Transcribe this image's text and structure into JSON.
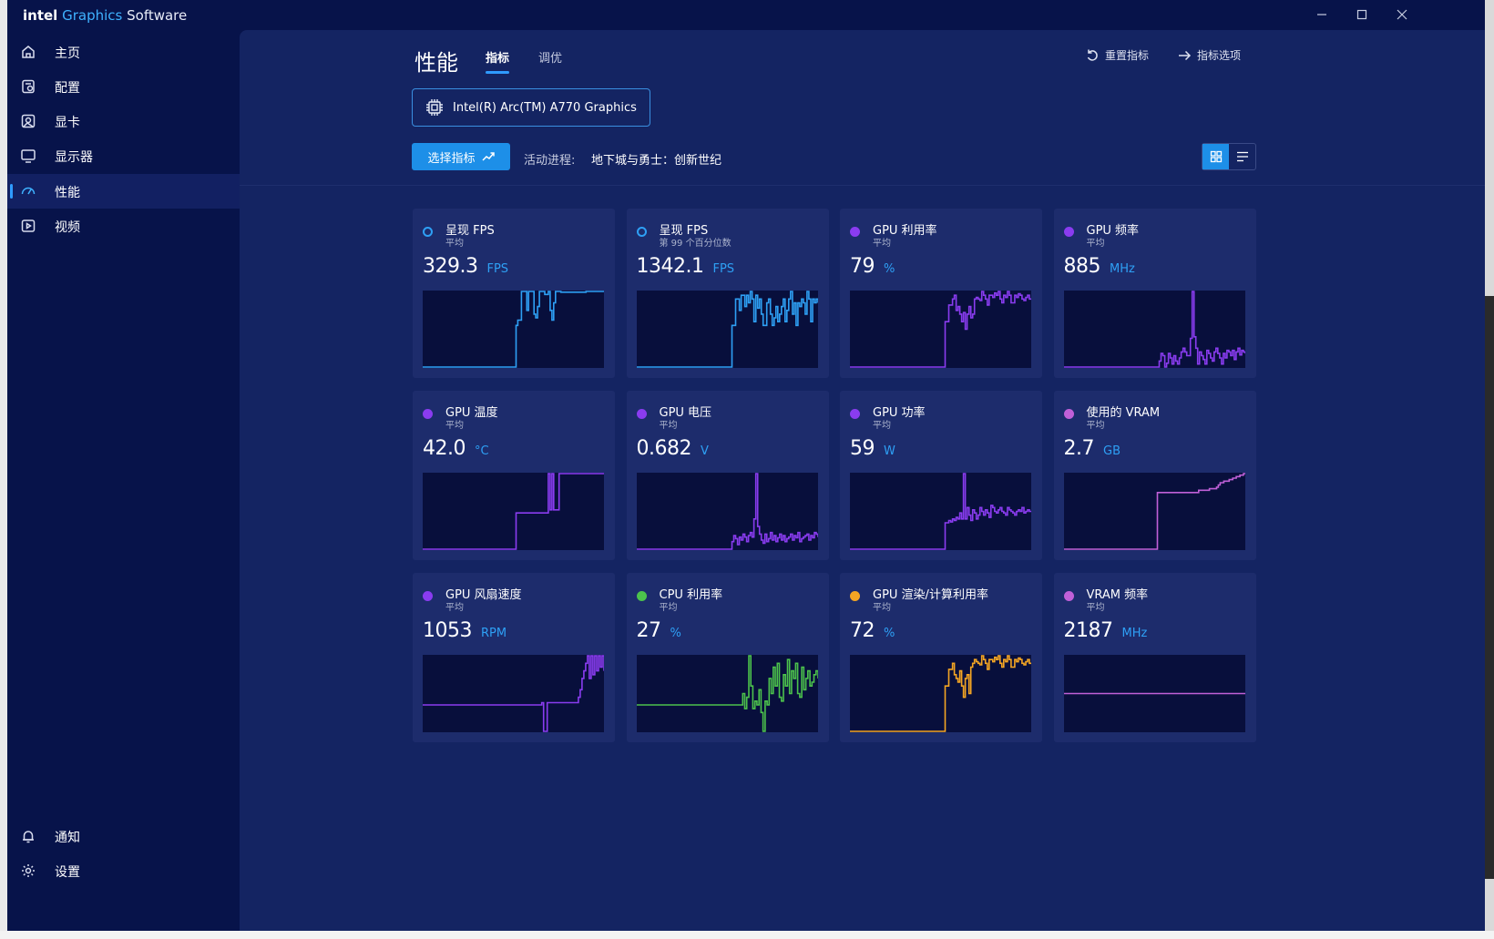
{
  "app": {
    "brand_intel": "intel",
    "brand_graphics": "Graphics",
    "brand_software": "Software"
  },
  "sidebar": {
    "items": [
      {
        "label": "主页",
        "icon": "home-icon"
      },
      {
        "label": "配置",
        "icon": "profile-icon"
      },
      {
        "label": "显卡",
        "icon": "graphics-card-icon"
      },
      {
        "label": "显示器",
        "icon": "monitor-icon"
      },
      {
        "label": "性能",
        "icon": "performance-gauge-icon",
        "active": true
      },
      {
        "label": "视频",
        "icon": "video-icon"
      }
    ],
    "bottom_items": [
      {
        "label": "通知",
        "icon": "bell-icon"
      },
      {
        "label": "设置",
        "icon": "settings-gear-icon"
      }
    ]
  },
  "header": {
    "title": "性能",
    "tabs": [
      {
        "label": "指标",
        "active": true
      },
      {
        "label": "调优",
        "active": false
      }
    ],
    "reset_label": "重置指标",
    "options_label": "指标选项"
  },
  "device": {
    "name": "Intel(R) Arc(TM) A770 Graphics"
  },
  "toolbar": {
    "select_metrics_label": "选择指标",
    "process_label": "活动进程:",
    "process_value": "地下城与勇士：创新世纪"
  },
  "colors": {
    "blue": "#2ea0f5",
    "purple": "#8a3cf0",
    "magenta": "#c060d8",
    "green": "#4cc24c",
    "orange": "#f5a623",
    "accent": "#1d8fe8"
  },
  "metrics": [
    {
      "title": "呈现 FPS",
      "sub": "平均",
      "value": "329.3",
      "unit": "FPS",
      "color": "#2ea0f5",
      "dot": "ring",
      "series": [
        0,
        0,
        0,
        0,
        0,
        0,
        0,
        0,
        0,
        0,
        0,
        0,
        0,
        0,
        0,
        0,
        0,
        0,
        0,
        0,
        0,
        0,
        0,
        0,
        0,
        0,
        0,
        0,
        0,
        0,
        0,
        0,
        0,
        0,
        0,
        0,
        0,
        0,
        0,
        0,
        0,
        0,
        0,
        0,
        0,
        0,
        0,
        0,
        0,
        0,
        0,
        0,
        55,
        62,
        62,
        100,
        100,
        100,
        75,
        100,
        100,
        100,
        70,
        65,
        80,
        100,
        100,
        100,
        96,
        96,
        100,
        75,
        62,
        85,
        100,
        100,
        100,
        99,
        99,
        99,
        99,
        99,
        99,
        99,
        99,
        99,
        99,
        99,
        99,
        99,
        99,
        100,
        100,
        100,
        100,
        100,
        100,
        100,
        100,
        100,
        100,
        100
      ]
    },
    {
      "title": "呈现 FPS",
      "sub": "第 99 个百分位数",
      "value": "1342.1",
      "unit": "FPS",
      "color": "#2ea0f5",
      "dot": "ring",
      "series": [
        0,
        0,
        0,
        0,
        0,
        0,
        0,
        0,
        0,
        0,
        0,
        0,
        0,
        0,
        0,
        0,
        0,
        0,
        0,
        0,
        0,
        0,
        0,
        0,
        0,
        0,
        0,
        0,
        0,
        0,
        0,
        0,
        0,
        0,
        0,
        0,
        0,
        0,
        0,
        0,
        0,
        0,
        0,
        0,
        0,
        0,
        0,
        0,
        0,
        0,
        0,
        0,
        55,
        55,
        90,
        90,
        75,
        95,
        95,
        80,
        95,
        85,
        100,
        90,
        60,
        95,
        78,
        90,
        70,
        55,
        55,
        85,
        90,
        70,
        55,
        65,
        80,
        60,
        70,
        80,
        90,
        60,
        75,
        90,
        100,
        70,
        85,
        55,
        85,
        80,
        90,
        85,
        70,
        100,
        90,
        60,
        90,
        85,
        90,
        85
      ]
    },
    {
      "title": "GPU 利用率",
      "sub": "平均",
      "value": "79",
      "unit": "%",
      "color": "#8a3cf0",
      "dot": "fill",
      "series": [
        0,
        0,
        0,
        0,
        0,
        0,
        0,
        0,
        0,
        0,
        0,
        0,
        0,
        0,
        0,
        0,
        0,
        0,
        0,
        0,
        0,
        0,
        0,
        0,
        0,
        0,
        0,
        0,
        0,
        0,
        0,
        0,
        0,
        0,
        0,
        0,
        0,
        0,
        0,
        0,
        0,
        0,
        0,
        0,
        0,
        0,
        0,
        0,
        0,
        0,
        0,
        0,
        60,
        60,
        82,
        82,
        90,
        95,
        75,
        80,
        70,
        60,
        72,
        50,
        70,
        80,
        65,
        70,
        90,
        92,
        90,
        88,
        100,
        95,
        90,
        82,
        95,
        95,
        92,
        98,
        95,
        100,
        90,
        85,
        95,
        92,
        100,
        95,
        85,
        85,
        95,
        92,
        97,
        95,
        90,
        88,
        92,
        95,
        90,
        90
      ]
    },
    {
      "title": "GPU 频率",
      "sub": "平均",
      "value": "885",
      "unit": "MHz",
      "color": "#8a3cf0",
      "dot": "fill",
      "series": [
        0,
        0,
        0,
        0,
        0,
        0,
        0,
        0,
        0,
        0,
        0,
        0,
        0,
        0,
        0,
        0,
        0,
        0,
        0,
        0,
        0,
        0,
        0,
        0,
        0,
        0,
        0,
        0,
        0,
        0,
        0,
        0,
        0,
        0,
        0,
        0,
        0,
        0,
        0,
        0,
        0,
        0,
        0,
        0,
        0,
        0,
        0,
        0,
        0,
        0,
        0,
        0,
        8,
        18,
        15,
        0,
        5,
        18,
        12,
        4,
        15,
        8,
        4,
        12,
        20,
        25,
        20,
        15,
        15,
        38,
        100,
        40,
        25,
        4,
        20,
        15,
        10,
        4,
        22,
        18,
        12,
        8,
        20,
        25,
        18,
        12,
        4,
        18,
        12,
        22,
        20,
        15,
        22,
        10,
        20,
        25,
        16,
        22,
        20,
        18
      ]
    },
    {
      "title": "GPU 温度",
      "sub": "平均",
      "value": "42.0",
      "unit": "°C",
      "color": "#8a3cf0",
      "dot": "fill",
      "series": [
        0,
        0,
        0,
        0,
        0,
        0,
        0,
        0,
        0,
        0,
        0,
        0,
        0,
        0,
        0,
        0,
        0,
        0,
        0,
        0,
        0,
        0,
        0,
        0,
        0,
        0,
        0,
        0,
        0,
        0,
        0,
        0,
        0,
        0,
        0,
        0,
        0,
        0,
        0,
        0,
        0,
        0,
        0,
        0,
        0,
        0,
        0,
        0,
        0,
        0,
        0,
        0,
        48,
        48,
        48,
        48,
        48,
        48,
        48,
        48,
        48,
        48,
        48,
        48,
        48,
        48,
        48,
        48,
        48,
        48,
        100,
        52,
        100,
        52,
        52,
        52,
        100,
        100,
        100,
        100,
        100,
        100,
        100,
        100,
        100,
        100,
        100,
        100,
        100,
        100,
        100,
        100,
        100,
        100,
        100,
        100,
        100,
        100,
        100,
        100,
        100,
        100
      ]
    },
    {
      "title": "GPU 电压",
      "sub": "平均",
      "value": "0.682",
      "unit": "V",
      "color": "#8a3cf0",
      "dot": "fill",
      "series": [
        0,
        0,
        0,
        0,
        0,
        0,
        0,
        0,
        0,
        0,
        0,
        0,
        0,
        0,
        0,
        0,
        0,
        0,
        0,
        0,
        0,
        0,
        0,
        0,
        0,
        0,
        0,
        0,
        0,
        0,
        0,
        0,
        0,
        0,
        0,
        0,
        0,
        0,
        0,
        0,
        0,
        0,
        0,
        0,
        0,
        0,
        0,
        0,
        0,
        0,
        0,
        0,
        10,
        18,
        14,
        6,
        16,
        12,
        20,
        16,
        10,
        18,
        22,
        16,
        40,
        100,
        30,
        20,
        12,
        8,
        20,
        10,
        14,
        22,
        12,
        18,
        10,
        15,
        20,
        12,
        18,
        10,
        14,
        16,
        20,
        12,
        18,
        15,
        22,
        10,
        14,
        16,
        18,
        20,
        12,
        18,
        15,
        22,
        20,
        16
      ]
    },
    {
      "title": "GPU 功率",
      "sub": "平均",
      "value": "59",
      "unit": "W",
      "color": "#8a3cf0",
      "dot": "fill",
      "series": [
        0,
        0,
        0,
        0,
        0,
        0,
        0,
        0,
        0,
        0,
        0,
        0,
        0,
        0,
        0,
        0,
        0,
        0,
        0,
        0,
        0,
        0,
        0,
        0,
        0,
        0,
        0,
        0,
        0,
        0,
        0,
        0,
        0,
        0,
        0,
        0,
        0,
        0,
        0,
        0,
        0,
        0,
        0,
        0,
        0,
        0,
        0,
        0,
        0,
        0,
        0,
        0,
        35,
        35,
        38,
        36,
        40,
        38,
        42,
        40,
        48,
        40,
        100,
        40,
        55,
        45,
        38,
        52,
        48,
        40,
        45,
        55,
        50,
        45,
        52,
        48,
        42,
        58,
        55,
        50,
        48,
        52,
        55,
        50,
        48,
        45,
        55,
        52,
        50,
        48,
        45,
        50,
        52,
        50,
        55,
        48,
        50,
        52,
        50,
        50
      ]
    },
    {
      "title": "使用的 VRAM",
      "sub": "平均",
      "value": "2.7",
      "unit": "GB",
      "color": "#c060d8",
      "dot": "fill",
      "series": [
        0,
        0,
        0,
        0,
        0,
        0,
        0,
        0,
        0,
        0,
        0,
        0,
        0,
        0,
        0,
        0,
        0,
        0,
        0,
        0,
        0,
        0,
        0,
        0,
        0,
        0,
        0,
        0,
        0,
        0,
        0,
        0,
        0,
        0,
        0,
        0,
        0,
        0,
        0,
        0,
        0,
        0,
        0,
        0,
        0,
        0,
        0,
        0,
        0,
        0,
        0,
        0,
        75,
        75,
        75,
        75,
        75,
        75,
        75,
        75,
        75,
        75,
        75,
        75,
        75,
        75,
        75,
        75,
        75,
        75,
        75,
        75,
        75,
        75,
        75,
        78,
        78,
        78,
        78,
        78,
        78,
        80,
        80,
        80,
        80,
        82,
        85,
        88,
        88,
        90,
        90,
        90,
        92,
        92,
        94,
        94,
        96,
        96,
        98,
        98,
        100,
        100
      ]
    },
    {
      "title": "GPU 风扇速度",
      "sub": "平均",
      "value": "1053",
      "unit": "RPM",
      "color": "#8a3cf0",
      "dot": "fill",
      "series": [
        35,
        35,
        35,
        35,
        35,
        35,
        35,
        35,
        35,
        35,
        35,
        35,
        35,
        35,
        35,
        35,
        35,
        35,
        35,
        35,
        35,
        35,
        35,
        35,
        35,
        35,
        35,
        35,
        35,
        35,
        35,
        35,
        35,
        35,
        35,
        35,
        35,
        35,
        35,
        35,
        35,
        35,
        35,
        35,
        35,
        35,
        35,
        35,
        35,
        35,
        35,
        35,
        35,
        35,
        35,
        35,
        35,
        35,
        35,
        35,
        35,
        35,
        35,
        35,
        35,
        38,
        0,
        0,
        38,
        38,
        38,
        38,
        38,
        38,
        38,
        38,
        38,
        38,
        38,
        38,
        38,
        38,
        38,
        38,
        38,
        45,
        55,
        70,
        80,
        90,
        100,
        70,
        100,
        75,
        100,
        80,
        100,
        85,
        100,
        80
      ]
    },
    {
      "title": "CPU 利用率",
      "sub": "平均",
      "value": "27",
      "unit": "%",
      "color": "#4cc24c",
      "dot": "fill",
      "series": [
        35,
        35,
        35,
        35,
        35,
        35,
        35,
        35,
        35,
        35,
        35,
        35,
        35,
        35,
        35,
        35,
        35,
        35,
        35,
        35,
        35,
        35,
        35,
        35,
        35,
        35,
        35,
        35,
        35,
        35,
        35,
        35,
        35,
        35,
        35,
        35,
        35,
        35,
        35,
        35,
        35,
        35,
        35,
        35,
        35,
        35,
        35,
        35,
        35,
        35,
        35,
        35,
        50,
        30,
        45,
        100,
        60,
        30,
        40,
        35,
        55,
        25,
        0,
        40,
        35,
        70,
        50,
        85,
        60,
        90,
        45,
        40,
        75,
        60,
        95,
        50,
        80,
        70,
        90,
        50,
        45,
        85,
        55,
        70,
        80,
        60,
        65,
        75,
        80,
        70
      ]
    },
    {
      "title": "GPU 渲染/计算利用率",
      "sub": "平均",
      "value": "72",
      "unit": "%",
      "color": "#f5a623",
      "dot": "fill",
      "series": [
        0,
        0,
        0,
        0,
        0,
        0,
        0,
        0,
        0,
        0,
        0,
        0,
        0,
        0,
        0,
        0,
        0,
        0,
        0,
        0,
        0,
        0,
        0,
        0,
        0,
        0,
        0,
        0,
        0,
        0,
        0,
        0,
        0,
        0,
        0,
        0,
        0,
        0,
        0,
        0,
        0,
        0,
        0,
        0,
        0,
        0,
        0,
        0,
        0,
        0,
        0,
        0,
        60,
        60,
        82,
        82,
        90,
        75,
        70,
        65,
        80,
        60,
        45,
        70,
        75,
        50,
        85,
        90,
        95,
        92,
        90,
        88,
        100,
        95,
        90,
        82,
        95,
        95,
        92,
        98,
        95,
        100,
        90,
        85,
        95,
        92,
        100,
        95,
        85,
        85,
        95,
        92,
        97,
        95,
        90,
        88,
        92,
        95,
        90,
        90
      ]
    },
    {
      "title": "VRAM 频率",
      "sub": "平均",
      "value": "2187",
      "unit": "MHz",
      "color": "#c060d8",
      "dot": "fill",
      "series": [
        50,
        50,
        50,
        50,
        50,
        50,
        50,
        50,
        50,
        50,
        50,
        50,
        50,
        50,
        50,
        50,
        50,
        50,
        50,
        50,
        50,
        50,
        50,
        50,
        50,
        50,
        50,
        50,
        50,
        50,
        50,
        50,
        50,
        50,
        50,
        50,
        50,
        50,
        50,
        50,
        50,
        50,
        50,
        50,
        50,
        50,
        50,
        50,
        50,
        50,
        50,
        50,
        50,
        50,
        50,
        50,
        50,
        50,
        50,
        50,
        50,
        50,
        50,
        50,
        50,
        50,
        50,
        50,
        50,
        50,
        50,
        50,
        50,
        50,
        50,
        50,
        50,
        50,
        50,
        50,
        50,
        50,
        50,
        50,
        50,
        50,
        50,
        50,
        50,
        50,
        50,
        50,
        50,
        50,
        50,
        50,
        50,
        50,
        50,
        50
      ]
    }
  ]
}
